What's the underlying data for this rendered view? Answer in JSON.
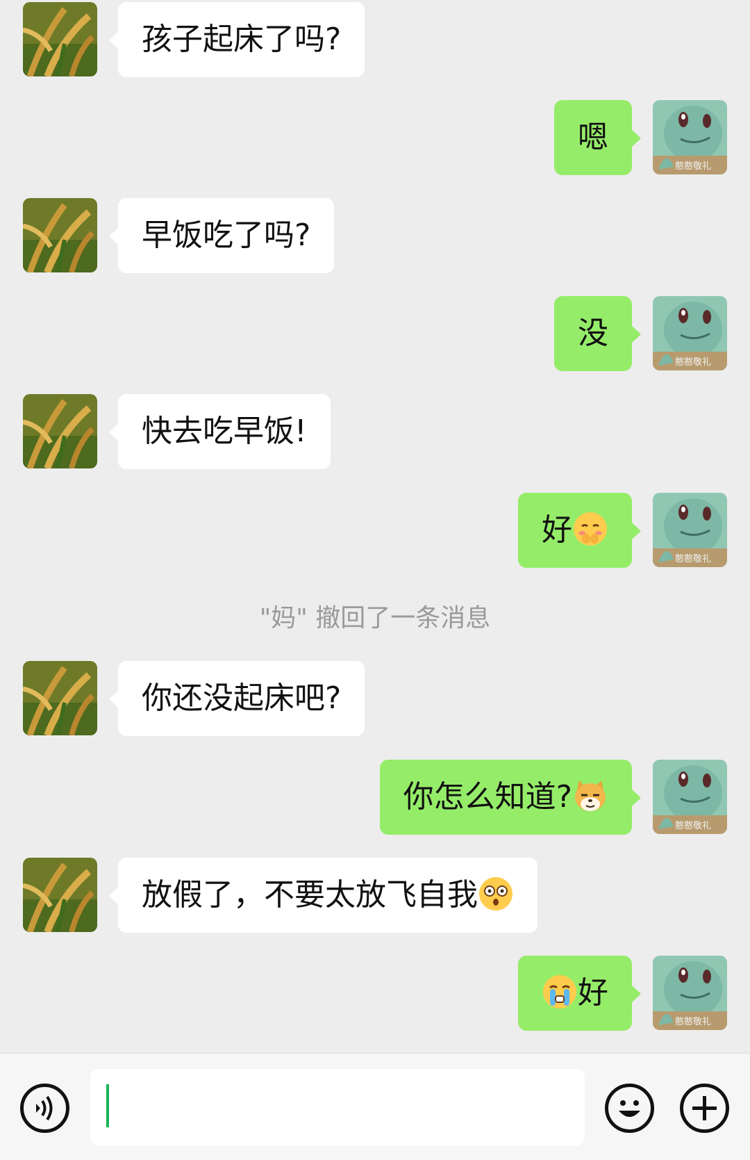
{
  "messages": [
    {
      "side": "left",
      "text": "孩子起床了吗?"
    },
    {
      "side": "right",
      "text": "嗯"
    },
    {
      "side": "left",
      "text": "早饭吃了吗?"
    },
    {
      "side": "right",
      "text": "没"
    },
    {
      "side": "left",
      "text": "快去吃早饭!"
    },
    {
      "side": "right",
      "text": "好",
      "emoji_after": "shy-face"
    },
    {
      "side": "left",
      "text": "你还没起床吧?"
    },
    {
      "side": "right",
      "text": "你怎么知道?",
      "emoji_after": "doge"
    },
    {
      "side": "left",
      "text": "放假了，不要太放飞自我",
      "emoji_after": "shocked-face"
    },
    {
      "side": "right",
      "text": "好",
      "emoji_before": "crying-face"
    }
  ],
  "system_note": "\"妈\" 撤回了一条消息",
  "avatars": {
    "left": "rice-plant-avatar",
    "right": "squirtle-avatar",
    "right_watermark": "憨憨敬礼"
  },
  "input_bar": {
    "voice_icon": "voice-icon",
    "emoji_icon": "emoji-icon",
    "plus_icon": "plus-icon"
  },
  "colors": {
    "background": "#ededed",
    "incoming_bubble": "#ffffff",
    "outgoing_bubble": "#95ec69",
    "system_text": "#9a9a9a",
    "caret": "#17b556"
  }
}
